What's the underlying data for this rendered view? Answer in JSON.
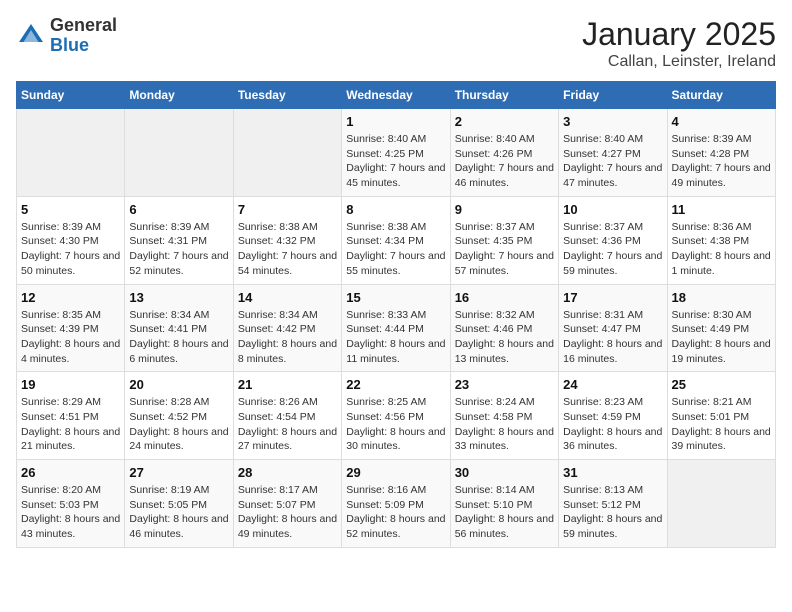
{
  "header": {
    "logo_general": "General",
    "logo_blue": "Blue",
    "title": "January 2025",
    "subtitle": "Callan, Leinster, Ireland"
  },
  "days_of_week": [
    "Sunday",
    "Monday",
    "Tuesday",
    "Wednesday",
    "Thursday",
    "Friday",
    "Saturday"
  ],
  "weeks": [
    [
      {
        "day": "",
        "info": ""
      },
      {
        "day": "",
        "info": ""
      },
      {
        "day": "",
        "info": ""
      },
      {
        "day": "1",
        "info": "Sunrise: 8:40 AM\nSunset: 4:25 PM\nDaylight: 7 hours and 45 minutes."
      },
      {
        "day": "2",
        "info": "Sunrise: 8:40 AM\nSunset: 4:26 PM\nDaylight: 7 hours and 46 minutes."
      },
      {
        "day": "3",
        "info": "Sunrise: 8:40 AM\nSunset: 4:27 PM\nDaylight: 7 hours and 47 minutes."
      },
      {
        "day": "4",
        "info": "Sunrise: 8:39 AM\nSunset: 4:28 PM\nDaylight: 7 hours and 49 minutes."
      }
    ],
    [
      {
        "day": "5",
        "info": "Sunrise: 8:39 AM\nSunset: 4:30 PM\nDaylight: 7 hours and 50 minutes."
      },
      {
        "day": "6",
        "info": "Sunrise: 8:39 AM\nSunset: 4:31 PM\nDaylight: 7 hours and 52 minutes."
      },
      {
        "day": "7",
        "info": "Sunrise: 8:38 AM\nSunset: 4:32 PM\nDaylight: 7 hours and 54 minutes."
      },
      {
        "day": "8",
        "info": "Sunrise: 8:38 AM\nSunset: 4:34 PM\nDaylight: 7 hours and 55 minutes."
      },
      {
        "day": "9",
        "info": "Sunrise: 8:37 AM\nSunset: 4:35 PM\nDaylight: 7 hours and 57 minutes."
      },
      {
        "day": "10",
        "info": "Sunrise: 8:37 AM\nSunset: 4:36 PM\nDaylight: 7 hours and 59 minutes."
      },
      {
        "day": "11",
        "info": "Sunrise: 8:36 AM\nSunset: 4:38 PM\nDaylight: 8 hours and 1 minute."
      }
    ],
    [
      {
        "day": "12",
        "info": "Sunrise: 8:35 AM\nSunset: 4:39 PM\nDaylight: 8 hours and 4 minutes."
      },
      {
        "day": "13",
        "info": "Sunrise: 8:34 AM\nSunset: 4:41 PM\nDaylight: 8 hours and 6 minutes."
      },
      {
        "day": "14",
        "info": "Sunrise: 8:34 AM\nSunset: 4:42 PM\nDaylight: 8 hours and 8 minutes."
      },
      {
        "day": "15",
        "info": "Sunrise: 8:33 AM\nSunset: 4:44 PM\nDaylight: 8 hours and 11 minutes."
      },
      {
        "day": "16",
        "info": "Sunrise: 8:32 AM\nSunset: 4:46 PM\nDaylight: 8 hours and 13 minutes."
      },
      {
        "day": "17",
        "info": "Sunrise: 8:31 AM\nSunset: 4:47 PM\nDaylight: 8 hours and 16 minutes."
      },
      {
        "day": "18",
        "info": "Sunrise: 8:30 AM\nSunset: 4:49 PM\nDaylight: 8 hours and 19 minutes."
      }
    ],
    [
      {
        "day": "19",
        "info": "Sunrise: 8:29 AM\nSunset: 4:51 PM\nDaylight: 8 hours and 21 minutes."
      },
      {
        "day": "20",
        "info": "Sunrise: 8:28 AM\nSunset: 4:52 PM\nDaylight: 8 hours and 24 minutes."
      },
      {
        "day": "21",
        "info": "Sunrise: 8:26 AM\nSunset: 4:54 PM\nDaylight: 8 hours and 27 minutes."
      },
      {
        "day": "22",
        "info": "Sunrise: 8:25 AM\nSunset: 4:56 PM\nDaylight: 8 hours and 30 minutes."
      },
      {
        "day": "23",
        "info": "Sunrise: 8:24 AM\nSunset: 4:58 PM\nDaylight: 8 hours and 33 minutes."
      },
      {
        "day": "24",
        "info": "Sunrise: 8:23 AM\nSunset: 4:59 PM\nDaylight: 8 hours and 36 minutes."
      },
      {
        "day": "25",
        "info": "Sunrise: 8:21 AM\nSunset: 5:01 PM\nDaylight: 8 hours and 39 minutes."
      }
    ],
    [
      {
        "day": "26",
        "info": "Sunrise: 8:20 AM\nSunset: 5:03 PM\nDaylight: 8 hours and 43 minutes."
      },
      {
        "day": "27",
        "info": "Sunrise: 8:19 AM\nSunset: 5:05 PM\nDaylight: 8 hours and 46 minutes."
      },
      {
        "day": "28",
        "info": "Sunrise: 8:17 AM\nSunset: 5:07 PM\nDaylight: 8 hours and 49 minutes."
      },
      {
        "day": "29",
        "info": "Sunrise: 8:16 AM\nSunset: 5:09 PM\nDaylight: 8 hours and 52 minutes."
      },
      {
        "day": "30",
        "info": "Sunrise: 8:14 AM\nSunset: 5:10 PM\nDaylight: 8 hours and 56 minutes."
      },
      {
        "day": "31",
        "info": "Sunrise: 8:13 AM\nSunset: 5:12 PM\nDaylight: 8 hours and 59 minutes."
      },
      {
        "day": "",
        "info": ""
      }
    ]
  ]
}
